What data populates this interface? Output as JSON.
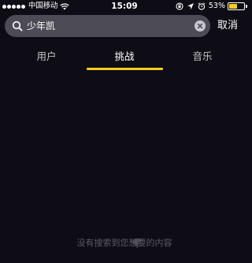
{
  "status_bar": {
    "carrier": "中国移动",
    "time": "15:09",
    "battery_percent": "53%",
    "battery_level": 0.53,
    "signal_dots": 5,
    "icons": [
      "wifi-icon",
      "rotation-lock-icon",
      "location-icon",
      "alarm-icon",
      "battery-icon"
    ]
  },
  "search": {
    "query": "少年凯",
    "icon": "search-icon",
    "clear_icon": "clear-icon",
    "cancel_label": "取消"
  },
  "tabs": {
    "items": [
      {
        "label": "用户",
        "active": false
      },
      {
        "label": "挑战",
        "active": true
      },
      {
        "label": "音乐",
        "active": false
      }
    ],
    "accent_color": "#f5cd1b"
  },
  "empty_state": {
    "message": "没有搜索到您想要的内容"
  },
  "colors": {
    "background": "#0e0d16",
    "search_field": "#4d4b56",
    "accent": "#f5cd1b"
  }
}
